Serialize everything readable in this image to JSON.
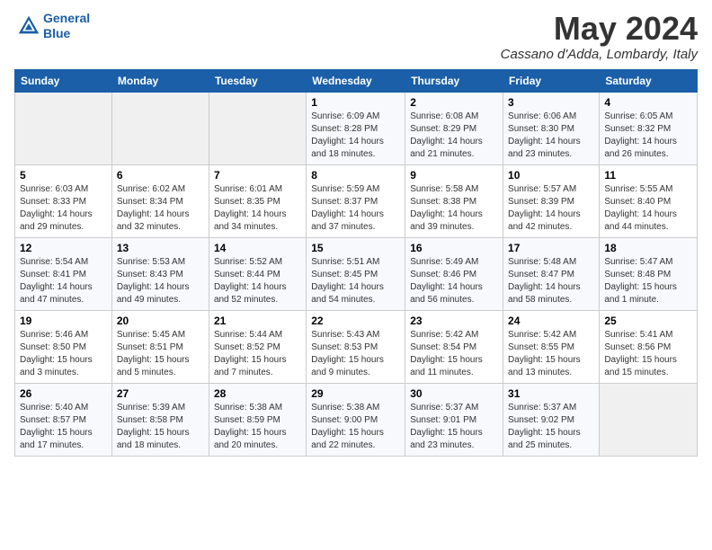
{
  "header": {
    "logo_line1": "General",
    "logo_line2": "Blue",
    "month": "May 2024",
    "location": "Cassano d'Adda, Lombardy, Italy"
  },
  "weekdays": [
    "Sunday",
    "Monday",
    "Tuesday",
    "Wednesday",
    "Thursday",
    "Friday",
    "Saturday"
  ],
  "weeks": [
    [
      {
        "day": "",
        "info": ""
      },
      {
        "day": "",
        "info": ""
      },
      {
        "day": "",
        "info": ""
      },
      {
        "day": "1",
        "info": "Sunrise: 6:09 AM\nSunset: 8:28 PM\nDaylight: 14 hours\nand 18 minutes."
      },
      {
        "day": "2",
        "info": "Sunrise: 6:08 AM\nSunset: 8:29 PM\nDaylight: 14 hours\nand 21 minutes."
      },
      {
        "day": "3",
        "info": "Sunrise: 6:06 AM\nSunset: 8:30 PM\nDaylight: 14 hours\nand 23 minutes."
      },
      {
        "day": "4",
        "info": "Sunrise: 6:05 AM\nSunset: 8:32 PM\nDaylight: 14 hours\nand 26 minutes."
      }
    ],
    [
      {
        "day": "5",
        "info": "Sunrise: 6:03 AM\nSunset: 8:33 PM\nDaylight: 14 hours\nand 29 minutes."
      },
      {
        "day": "6",
        "info": "Sunrise: 6:02 AM\nSunset: 8:34 PM\nDaylight: 14 hours\nand 32 minutes."
      },
      {
        "day": "7",
        "info": "Sunrise: 6:01 AM\nSunset: 8:35 PM\nDaylight: 14 hours\nand 34 minutes."
      },
      {
        "day": "8",
        "info": "Sunrise: 5:59 AM\nSunset: 8:37 PM\nDaylight: 14 hours\nand 37 minutes."
      },
      {
        "day": "9",
        "info": "Sunrise: 5:58 AM\nSunset: 8:38 PM\nDaylight: 14 hours\nand 39 minutes."
      },
      {
        "day": "10",
        "info": "Sunrise: 5:57 AM\nSunset: 8:39 PM\nDaylight: 14 hours\nand 42 minutes."
      },
      {
        "day": "11",
        "info": "Sunrise: 5:55 AM\nSunset: 8:40 PM\nDaylight: 14 hours\nand 44 minutes."
      }
    ],
    [
      {
        "day": "12",
        "info": "Sunrise: 5:54 AM\nSunset: 8:41 PM\nDaylight: 14 hours\nand 47 minutes."
      },
      {
        "day": "13",
        "info": "Sunrise: 5:53 AM\nSunset: 8:43 PM\nDaylight: 14 hours\nand 49 minutes."
      },
      {
        "day": "14",
        "info": "Sunrise: 5:52 AM\nSunset: 8:44 PM\nDaylight: 14 hours\nand 52 minutes."
      },
      {
        "day": "15",
        "info": "Sunrise: 5:51 AM\nSunset: 8:45 PM\nDaylight: 14 hours\nand 54 minutes."
      },
      {
        "day": "16",
        "info": "Sunrise: 5:49 AM\nSunset: 8:46 PM\nDaylight: 14 hours\nand 56 minutes."
      },
      {
        "day": "17",
        "info": "Sunrise: 5:48 AM\nSunset: 8:47 PM\nDaylight: 14 hours\nand 58 minutes."
      },
      {
        "day": "18",
        "info": "Sunrise: 5:47 AM\nSunset: 8:48 PM\nDaylight: 15 hours\nand 1 minute."
      }
    ],
    [
      {
        "day": "19",
        "info": "Sunrise: 5:46 AM\nSunset: 8:50 PM\nDaylight: 15 hours\nand 3 minutes."
      },
      {
        "day": "20",
        "info": "Sunrise: 5:45 AM\nSunset: 8:51 PM\nDaylight: 15 hours\nand 5 minutes."
      },
      {
        "day": "21",
        "info": "Sunrise: 5:44 AM\nSunset: 8:52 PM\nDaylight: 15 hours\nand 7 minutes."
      },
      {
        "day": "22",
        "info": "Sunrise: 5:43 AM\nSunset: 8:53 PM\nDaylight: 15 hours\nand 9 minutes."
      },
      {
        "day": "23",
        "info": "Sunrise: 5:42 AM\nSunset: 8:54 PM\nDaylight: 15 hours\nand 11 minutes."
      },
      {
        "day": "24",
        "info": "Sunrise: 5:42 AM\nSunset: 8:55 PM\nDaylight: 15 hours\nand 13 minutes."
      },
      {
        "day": "25",
        "info": "Sunrise: 5:41 AM\nSunset: 8:56 PM\nDaylight: 15 hours\nand 15 minutes."
      }
    ],
    [
      {
        "day": "26",
        "info": "Sunrise: 5:40 AM\nSunset: 8:57 PM\nDaylight: 15 hours\nand 17 minutes."
      },
      {
        "day": "27",
        "info": "Sunrise: 5:39 AM\nSunset: 8:58 PM\nDaylight: 15 hours\nand 18 minutes."
      },
      {
        "day": "28",
        "info": "Sunrise: 5:38 AM\nSunset: 8:59 PM\nDaylight: 15 hours\nand 20 minutes."
      },
      {
        "day": "29",
        "info": "Sunrise: 5:38 AM\nSunset: 9:00 PM\nDaylight: 15 hours\nand 22 minutes."
      },
      {
        "day": "30",
        "info": "Sunrise: 5:37 AM\nSunset: 9:01 PM\nDaylight: 15 hours\nand 23 minutes."
      },
      {
        "day": "31",
        "info": "Sunrise: 5:37 AM\nSunset: 9:02 PM\nDaylight: 15 hours\nand 25 minutes."
      },
      {
        "day": "",
        "info": ""
      }
    ]
  ]
}
